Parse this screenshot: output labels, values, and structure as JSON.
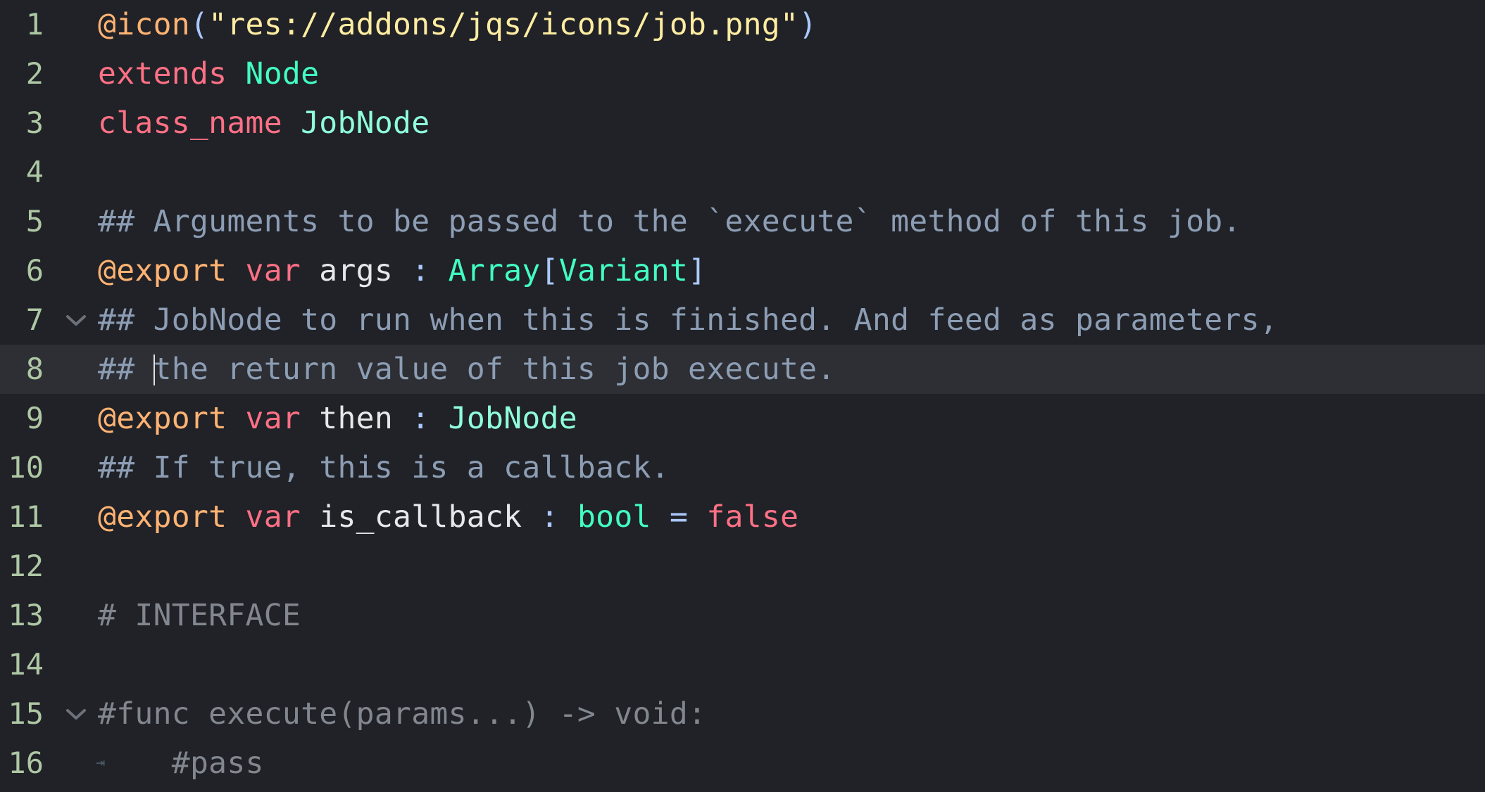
{
  "editor": {
    "current_line": 8,
    "lines": [
      {
        "number": "1",
        "tokens": [
          {
            "text": "@icon",
            "kind": "annotation"
          },
          {
            "text": "(",
            "kind": "symbol"
          },
          {
            "text": "\"res://addons/jqs/icons/job.png\"",
            "kind": "string"
          },
          {
            "text": ")",
            "kind": "symbol"
          }
        ]
      },
      {
        "number": "2",
        "tokens": [
          {
            "text": "extends",
            "kind": "keyword"
          },
          {
            "text": " ",
            "kind": "ident"
          },
          {
            "text": "Node",
            "kind": "builtin-type"
          }
        ]
      },
      {
        "number": "3",
        "tokens": [
          {
            "text": "class_name",
            "kind": "keyword"
          },
          {
            "text": " ",
            "kind": "ident"
          },
          {
            "text": "JobNode",
            "kind": "type"
          }
        ]
      },
      {
        "number": "4",
        "tokens": []
      },
      {
        "number": "5",
        "tokens": [
          {
            "text": "## Arguments to be passed to the `execute` method of this job.",
            "kind": "doc"
          }
        ]
      },
      {
        "number": "6",
        "tokens": [
          {
            "text": "@export",
            "kind": "annotation"
          },
          {
            "text": " ",
            "kind": "ident"
          },
          {
            "text": "var",
            "kind": "keyword"
          },
          {
            "text": " args ",
            "kind": "ident"
          },
          {
            "text": ":",
            "kind": "symbol"
          },
          {
            "text": " ",
            "kind": "ident"
          },
          {
            "text": "Array",
            "kind": "builtin-type"
          },
          {
            "text": "[",
            "kind": "symbol"
          },
          {
            "text": "Variant",
            "kind": "builtin-type"
          },
          {
            "text": "]",
            "kind": "symbol"
          }
        ]
      },
      {
        "number": "7",
        "fold": true,
        "tokens": [
          {
            "text": "## JobNode to run when this is finished. And feed as parameters,",
            "kind": "doc"
          }
        ]
      },
      {
        "number": "8",
        "caret_after": "## ",
        "tokens": [
          {
            "text": "## ",
            "kind": "doc"
          },
          {
            "text": "the return value of this job execute.",
            "kind": "doc"
          }
        ]
      },
      {
        "number": "9",
        "tokens": [
          {
            "text": "@export",
            "kind": "annotation"
          },
          {
            "text": " ",
            "kind": "ident"
          },
          {
            "text": "var",
            "kind": "keyword"
          },
          {
            "text": " then ",
            "kind": "ident"
          },
          {
            "text": ":",
            "kind": "symbol"
          },
          {
            "text": " ",
            "kind": "ident"
          },
          {
            "text": "JobNode",
            "kind": "type"
          }
        ]
      },
      {
        "number": "10",
        "tokens": [
          {
            "text": "## If true, this is a callback.",
            "kind": "doc"
          }
        ]
      },
      {
        "number": "11",
        "tokens": [
          {
            "text": "@export",
            "kind": "annotation"
          },
          {
            "text": " ",
            "kind": "ident"
          },
          {
            "text": "var",
            "kind": "keyword"
          },
          {
            "text": " is_callback ",
            "kind": "ident"
          },
          {
            "text": ":",
            "kind": "symbol"
          },
          {
            "text": " ",
            "kind": "ident"
          },
          {
            "text": "bool",
            "kind": "builtin-type"
          },
          {
            "text": " ",
            "kind": "ident"
          },
          {
            "text": "=",
            "kind": "symbol"
          },
          {
            "text": " ",
            "kind": "ident"
          },
          {
            "text": "false",
            "kind": "keyword"
          }
        ]
      },
      {
        "number": "12",
        "tokens": []
      },
      {
        "number": "13",
        "tokens": [
          {
            "text": "# INTERFACE",
            "kind": "comment"
          }
        ]
      },
      {
        "number": "14",
        "tokens": []
      },
      {
        "number": "15",
        "fold": true,
        "tokens": [
          {
            "text": "#func execute(params...) -> void:",
            "kind": "comment"
          }
        ]
      },
      {
        "number": "16",
        "tab": true,
        "tokens": [
          {
            "text": "    #pass",
            "kind": "comment"
          }
        ]
      }
    ]
  },
  "colors": {
    "background": "#202227",
    "current_line": "#2d2f34",
    "line_numbers": "#aec7a4",
    "annotation": "#ffb373",
    "keyword": "#ff7085",
    "type": "#8fffdb",
    "builtin_type": "#42ffc2",
    "string": "#ffeda1",
    "symbol": "#abc9ff",
    "doc_comment": "#8c9db4",
    "comment": "#82878f"
  },
  "icons": {
    "fold": "chevron-down-icon",
    "tab": "tab-indent-icon"
  }
}
